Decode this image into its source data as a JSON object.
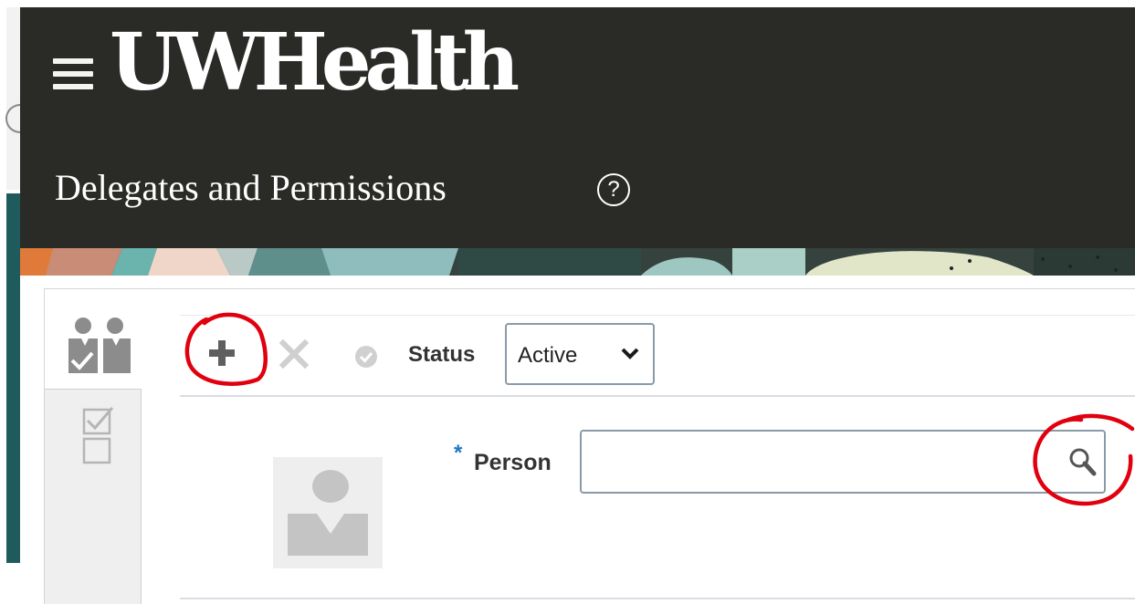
{
  "app": {
    "brand_name": "UWHealth",
    "page_title": "Delegates and Permissions",
    "help_glyph": "?"
  },
  "toolbar": {
    "add_icon": "plus-icon",
    "delete_icon": "x-icon",
    "approve_icon": "check-circle-icon",
    "status_label": "Status",
    "status_value": "Active"
  },
  "form": {
    "required_marker": "*",
    "person_label": "Person",
    "person_value": "",
    "search_icon": "magnifier-icon"
  },
  "annotations": {
    "color": "#e0000e",
    "circled": [
      "add-button",
      "person-search-button"
    ]
  },
  "colors": {
    "header_bg": "#2a2a27",
    "required_marker": "#1f77c0"
  }
}
